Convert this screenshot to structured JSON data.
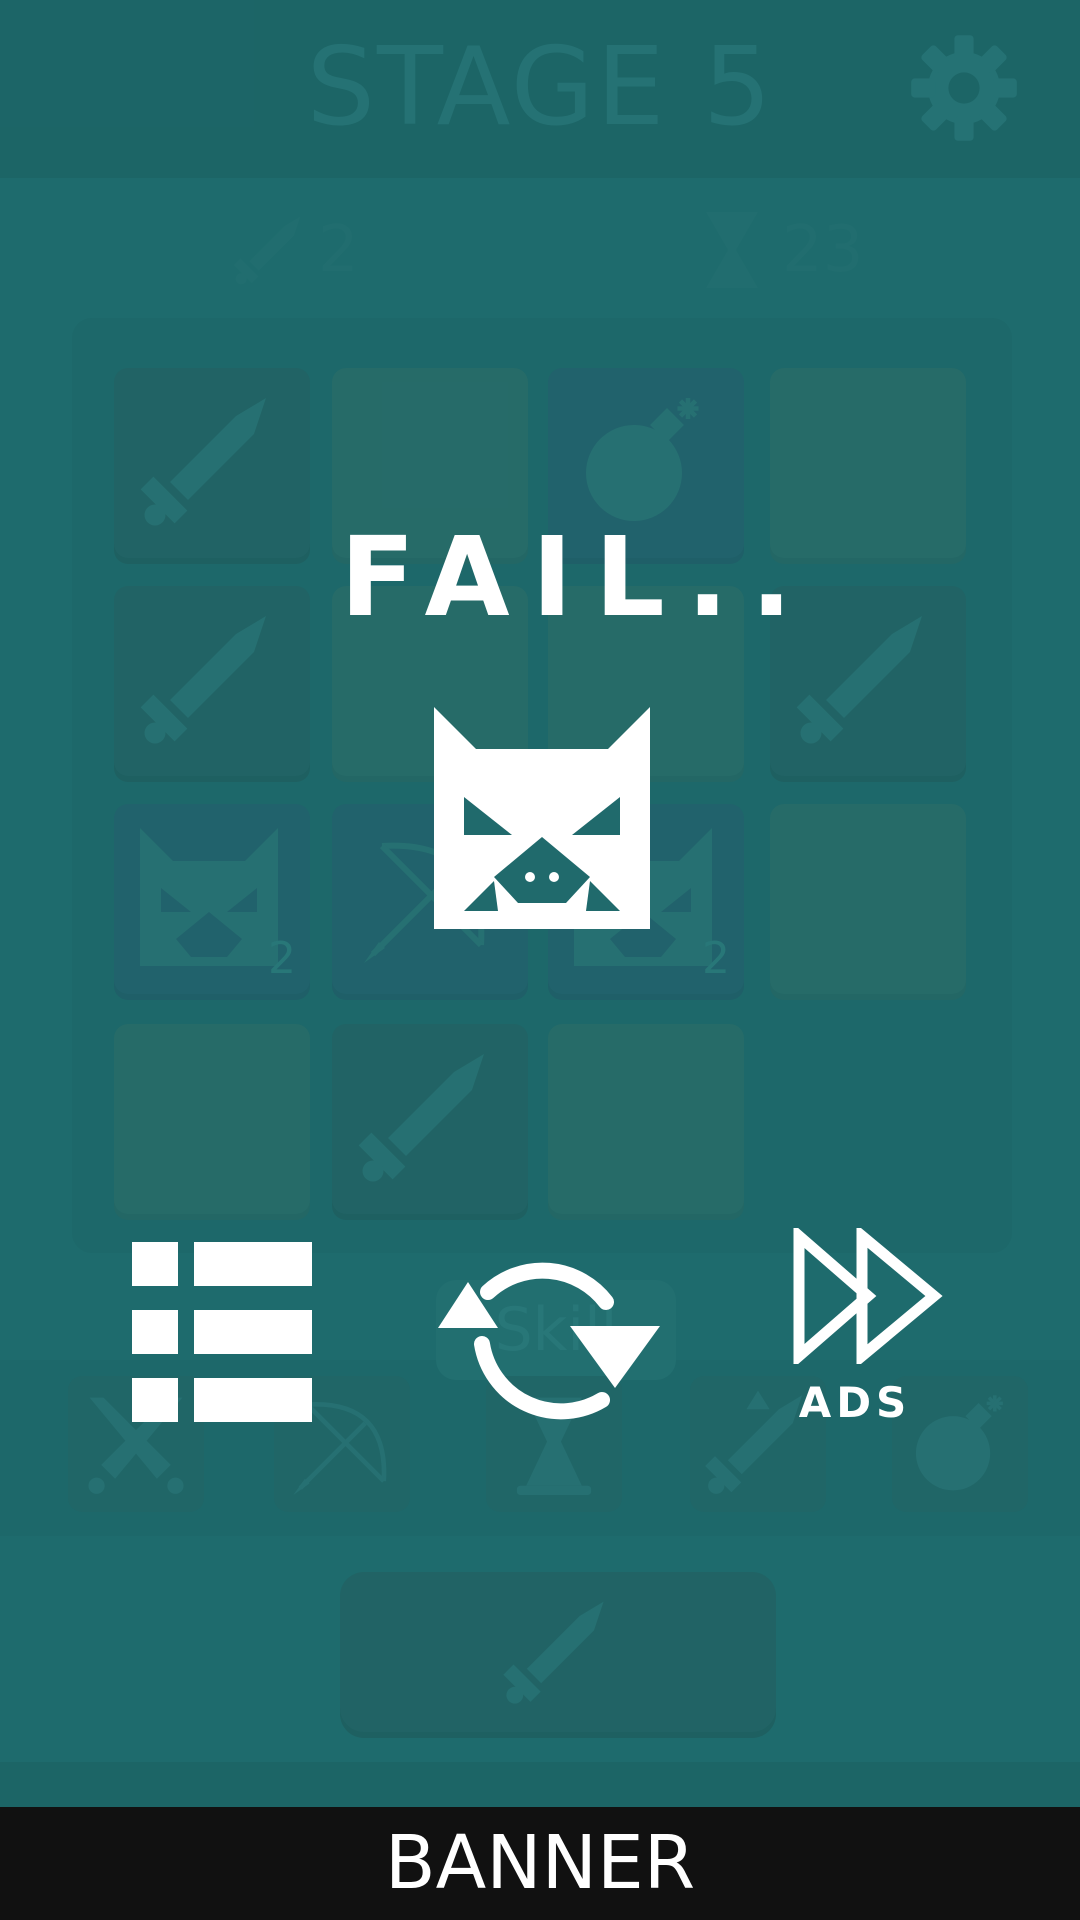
{
  "header": {
    "stage_title": "STAGE 5"
  },
  "stats": {
    "attack_value": "2",
    "time_value": "23"
  },
  "board": {
    "tiles": [
      {
        "row": 0,
        "col": 0,
        "style": "dark",
        "icon": "sword-icon",
        "sub": ""
      },
      {
        "row": 0,
        "col": 1,
        "style": "green",
        "icon": "",
        "sub": ""
      },
      {
        "row": 0,
        "col": 2,
        "style": "blue",
        "icon": "bomb-icon",
        "sub": ""
      },
      {
        "row": 0,
        "col": 3,
        "style": "green",
        "icon": "",
        "sub": ""
      },
      {
        "row": 1,
        "col": 0,
        "style": "dark",
        "icon": "sword-icon",
        "sub": ""
      },
      {
        "row": 1,
        "col": 1,
        "style": "green",
        "icon": "",
        "sub": ""
      },
      {
        "row": 1,
        "col": 2,
        "style": "green",
        "icon": "",
        "sub": ""
      },
      {
        "row": 1,
        "col": 3,
        "style": "dark",
        "icon": "sword-icon",
        "sub": ""
      },
      {
        "row": 2,
        "col": 0,
        "style": "blue",
        "icon": "cat-monster-icon",
        "sub": "2"
      },
      {
        "row": 2,
        "col": 1,
        "style": "blue",
        "icon": "bow-icon",
        "sub": ""
      },
      {
        "row": 2,
        "col": 2,
        "style": "blue",
        "icon": "cat-monster-icon",
        "sub": "2"
      },
      {
        "row": 2,
        "col": 3,
        "style": "green",
        "icon": "",
        "sub": ""
      },
      {
        "row": 3,
        "col": 0,
        "style": "green",
        "icon": "",
        "sub": ""
      },
      {
        "row": 3,
        "col": 1,
        "style": "dark",
        "icon": "sword-icon",
        "sub": ""
      },
      {
        "row": 3,
        "col": 2,
        "style": "green",
        "icon": "",
        "sub": ""
      }
    ]
  },
  "skills": {
    "label": "Skill",
    "items": [
      "crossed-swords-icon",
      "bow-icon",
      "hourglass-icon",
      "sword-up-icon",
      "bomb-icon"
    ]
  },
  "result": {
    "title": "FAIL..",
    "ads_label": "ADS"
  },
  "banner": {
    "text": "BANNER"
  },
  "colors": {
    "background": "#206a6c",
    "faint_icon": "#2c7173",
    "overlay_icon": "#ffffff",
    "banner_bg": "#111111"
  }
}
